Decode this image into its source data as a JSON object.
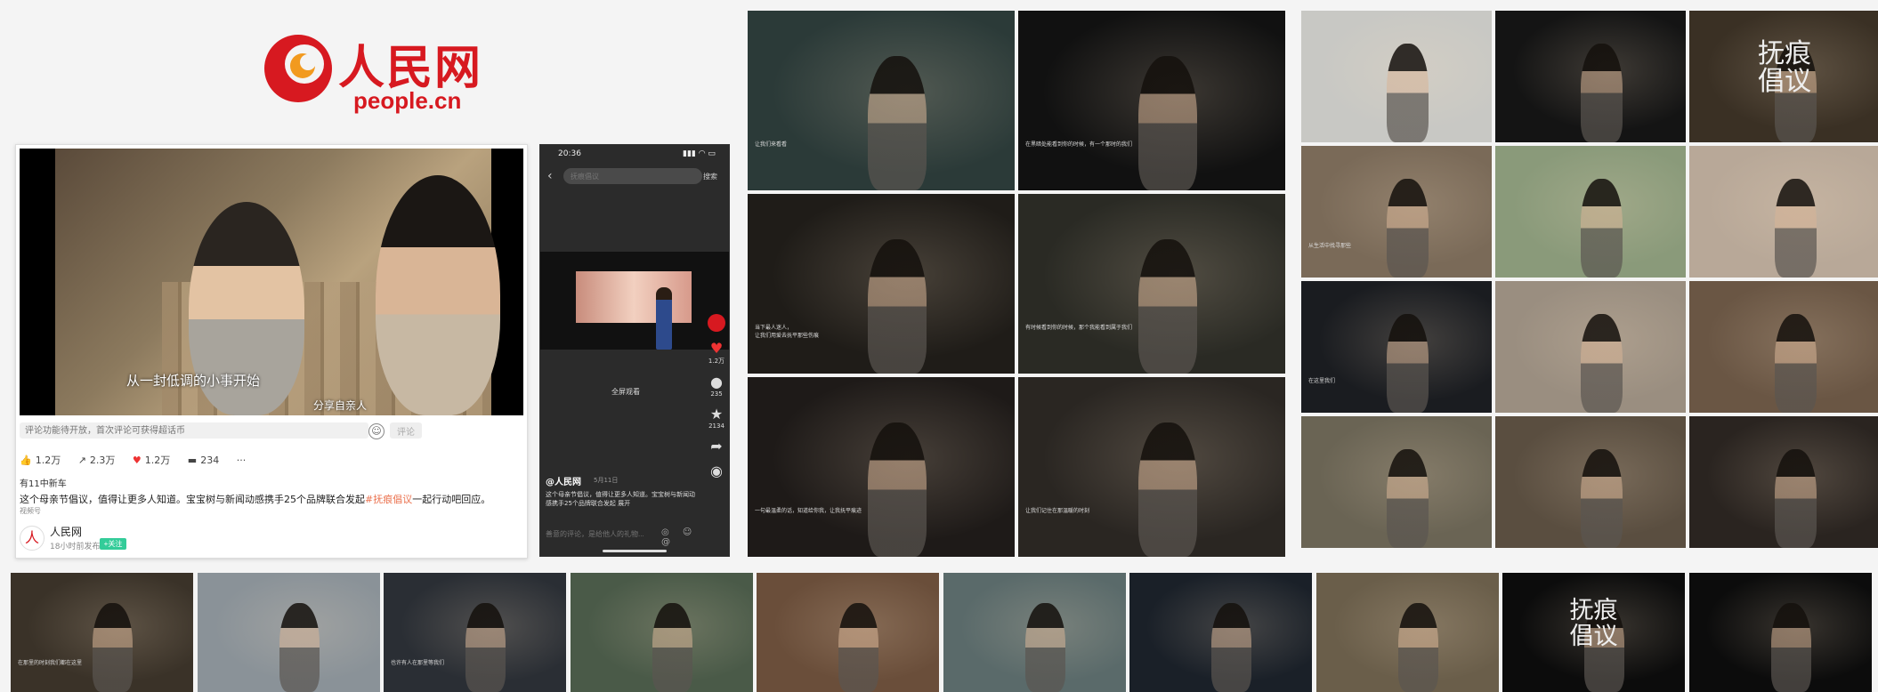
{
  "logo": {
    "cn": "人民网",
    "en": "people.cn"
  },
  "weibo": {
    "subtitle_main": "从一封低调的小事开始",
    "subtitle_small": "分享自亲人",
    "comment_placeholder": "评论功能待开放，首次评论可获得超话币",
    "send_label": "评论",
    "actions": {
      "like_icon": "thumbs-up-icon",
      "like": "1.2万",
      "share": "2.3万",
      "heart": "1.2万",
      "comment": "234",
      "more": "···"
    },
    "post_meta": "有11中新车",
    "post_text_before": "这个母亲节倡议，值得让更多人知道。宝宝树与新闻动感携手25个品牌联合发起",
    "post_hashtag": "#抚痕倡议",
    "post_text_after": "一起行动吧回应。",
    "post_tag": "视频号",
    "author_name": "人民网",
    "author_sub": "18小时前发布",
    "follow_label": "+关注"
  },
  "phone": {
    "time": "20:36",
    "signal": "▮▮▮ ◠ ▭",
    "search_placeholder": "抚痕倡议",
    "search_btn": "搜索",
    "fullscreen": "全屏观看",
    "side": {
      "share_count": "235",
      "star_count": "2134",
      "like_count": "1.2万"
    },
    "author": "@人民网",
    "date": "5月11日",
    "desc": "这个母亲节倡议，值得让更多人知道。宝宝树与新闻动感携手25个品牌联合发起 展开",
    "comment_placeholder": "善意的评论，是给他人的礼物...",
    "comment_icons": "◎ ☺ @"
  },
  "frames_mid": [
    {
      "caption": "让我们来看看",
      "bg": "#2b3a38"
    },
    {
      "caption": "在黑暗处能看到你的时候，有一个那时的我们",
      "bg": "#111"
    },
    {
      "caption": "当下最人迷人，\n让我们用爱去抚平那些伤痕",
      "bg": "#1f1c18"
    },
    {
      "caption": "有时候看到你的时候，那个我能看到属于我们",
      "bg": "#2a2a24"
    },
    {
      "caption": "一句最温柔的话，知道给你我，让我抚平痕迹",
      "bg": "#1e1a18"
    },
    {
      "caption": "让我们记住在那温暖的时刻",
      "bg": "#2a2622"
    }
  ],
  "frames_right": [
    {
      "caption": "",
      "bg": "#c8c8c4",
      "title": ""
    },
    {
      "caption": "",
      "bg": "#141414",
      "title": ""
    },
    {
      "caption": "",
      "bg": "#3a3024",
      "title": "抚痕\n倡议"
    },
    {
      "caption": "从生活中找寻那些",
      "bg": "#7a6a58",
      "title": ""
    },
    {
      "caption": "",
      "bg": "#8a9a7a",
      "title": ""
    },
    {
      "caption": "",
      "bg": "#b8a898",
      "title": ""
    },
    {
      "caption": "在这里我们",
      "bg": "#1a1c20",
      "title": ""
    },
    {
      "caption": "",
      "bg": "#9a8e80",
      "title": ""
    },
    {
      "caption": "",
      "bg": "#6a5644",
      "title": ""
    },
    {
      "caption": "",
      "bg": "#6a6454",
      "title": ""
    },
    {
      "caption": "",
      "bg": "#5a4e40",
      "title": ""
    },
    {
      "caption": "",
      "bg": "#2a2420",
      "title": ""
    }
  ],
  "frames_bottom": [
    {
      "caption": "在那里的时刻我们都在这里",
      "bg": "#3a3228",
      "title": ""
    },
    {
      "caption": "",
      "bg": "#8a9298",
      "title": ""
    },
    {
      "caption": "也许有人在那里等我们",
      "bg": "#2a2e34",
      "title": ""
    },
    {
      "caption": "",
      "bg": "#4a5a48",
      "title": ""
    },
    {
      "caption": "",
      "bg": "#6a4e3a",
      "title": ""
    },
    {
      "caption": "",
      "bg": "#5a6a6a",
      "title": ""
    },
    {
      "caption": "",
      "bg": "#1a2028",
      "title": ""
    },
    {
      "caption": "",
      "bg": "#6a5e4a",
      "title": ""
    },
    {
      "caption": "",
      "bg": "#0c0c0c",
      "title": "抚痕\n倡议"
    },
    {
      "caption": "",
      "bg": "#0c0c0c",
      "title": ""
    }
  ],
  "colors": {
    "brand": "#d71920",
    "hashtag": "#eb7350"
  }
}
